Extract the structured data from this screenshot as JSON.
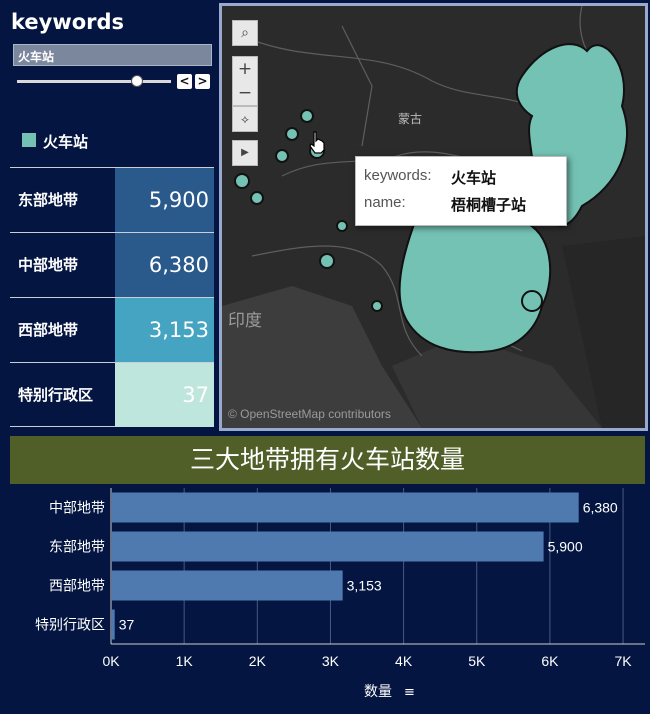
{
  "filter": {
    "title": "keywords",
    "selected_value": "火车站",
    "prev_label": "<",
    "next_label": ">"
  },
  "legend": {
    "label": "火车站",
    "color": "#74c2b4"
  },
  "regions": [
    {
      "name": "东部地带",
      "value": "5,900",
      "color": "#2a5a8c"
    },
    {
      "name": "中部地带",
      "value": "6,380",
      "color": "#2a5a8c"
    },
    {
      "name": "西部地带",
      "value": "3,153",
      "color": "#45a4c2"
    },
    {
      "name": "特别行政区",
      "value": "37",
      "color": "#bfe6dc"
    }
  ],
  "map": {
    "attribution": "© OpenStreetMap contributors",
    "labels": {
      "mongolia": "蒙古",
      "india": "印度"
    },
    "tools": {
      "search": "search-icon",
      "zoom_in": "+",
      "zoom_out": "−",
      "select": "lasso-icon",
      "expand": "play-icon"
    },
    "point_color": "#74c2b4",
    "tooltip": {
      "key1": "keywords:",
      "val1": "火车站",
      "key2": "name:",
      "val2": "梧桐槽子站"
    }
  },
  "chart_title": "三大地带拥有火车站数量",
  "chart_data": {
    "type": "bar",
    "orientation": "horizontal",
    "categories": [
      "中部地带",
      "东部地带",
      "西部地带",
      "特别行政区"
    ],
    "values": [
      6380,
      5900,
      3153,
      37
    ],
    "value_labels": [
      "6,380",
      "5,900",
      "3,153",
      "37"
    ],
    "xlabel": "数量",
    "xlim": [
      0,
      7300
    ],
    "xticks": [
      0,
      1000,
      2000,
      3000,
      4000,
      5000,
      6000,
      7000
    ],
    "xtick_labels": [
      "0K",
      "1K",
      "2K",
      "3K",
      "4K",
      "5K",
      "6K",
      "7K"
    ],
    "grid": true,
    "bar_color": "#4f7ab0"
  }
}
